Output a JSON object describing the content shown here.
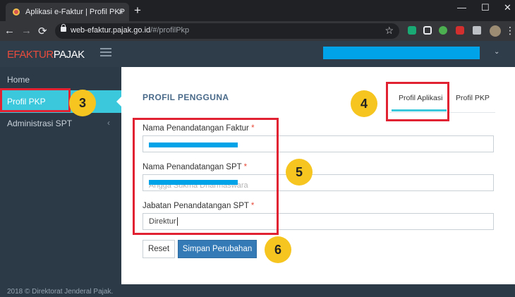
{
  "browser": {
    "tab_title": "Aplikasi e-Faktur | Profil PKP",
    "tab_close": "×",
    "new_tab": "+",
    "minimize": "—",
    "maximize": "☐",
    "close_window": "✕",
    "url_host": "web-efaktur.pajak.go.id",
    "url_path": "/#/profilPkp",
    "back_icon": "←",
    "forward_icon": "→",
    "reload_icon": "⟳",
    "star_icon": "☆",
    "menu_icon": "⋮"
  },
  "app": {
    "logo_part1": "EFAKTUR",
    "logo_part2": "PAJAK",
    "user_chevron": "⌄"
  },
  "sidebar": {
    "items": [
      {
        "label": "Home"
      },
      {
        "label": "Profil PKP"
      },
      {
        "label": "Administrasi SPT",
        "arrow": "‹"
      }
    ]
  },
  "page": {
    "title": "PROFIL PENGGUNA",
    "tabs": [
      {
        "label": "Profil Aplikasi"
      },
      {
        "label": "Profil PKP"
      }
    ]
  },
  "form": {
    "required_mark": "*",
    "fields": [
      {
        "label": "Nama Penandatangan Faktur",
        "value": ""
      },
      {
        "label": "Nama Penandatangan SPT",
        "value": "Angga Sukma Dharmaswara"
      },
      {
        "label": "Jabatan Penandatangan SPT",
        "value": "Direktur"
      }
    ],
    "reset_label": "Reset",
    "save_label": "Simpan Perubahan"
  },
  "footer": {
    "text": "2018 © Direktorat Jenderal Pajak."
  },
  "annotations": [
    "3",
    "4",
    "5",
    "6"
  ],
  "colors": {
    "sidebar_active": "#3cc8dc",
    "primary_button": "#337ab7",
    "annotation_red": "#e02232",
    "annotation_badge": "#f6c51f",
    "redaction": "#00a2e8"
  }
}
